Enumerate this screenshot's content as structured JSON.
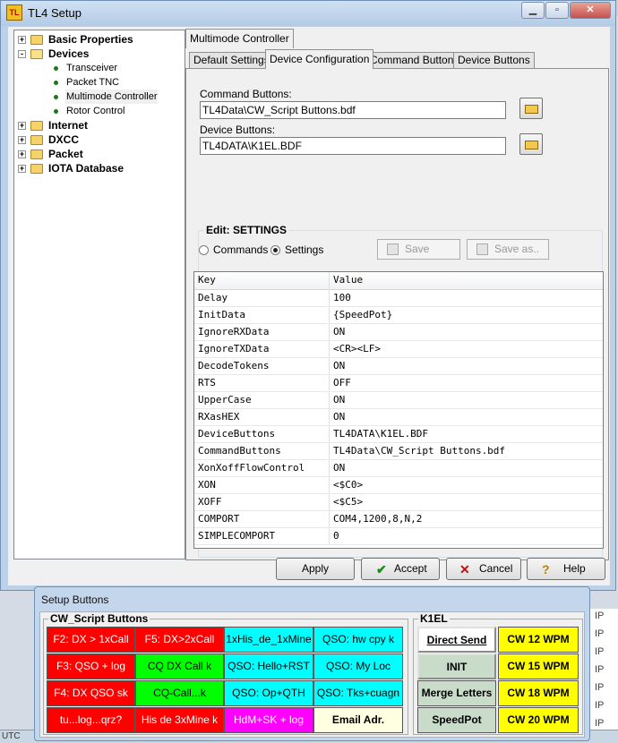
{
  "window": {
    "title": "TL4 Setup",
    "app_icon_text": "TL"
  },
  "tree": {
    "items": [
      {
        "label": "Basic Properties",
        "expander": "+"
      },
      {
        "label": "Devices",
        "expander": "-"
      },
      {
        "label": "Transceiver"
      },
      {
        "label": "Packet TNC"
      },
      {
        "label": "Multimode Controller"
      },
      {
        "label": "Rotor Control"
      },
      {
        "label": "Internet",
        "expander": "+"
      },
      {
        "label": "DXCC",
        "expander": "+"
      },
      {
        "label": "Packet",
        "expander": "+"
      },
      {
        "label": "IOTA Database",
        "expander": "+"
      }
    ]
  },
  "top_tab": {
    "label": "Multimode Controller"
  },
  "tabs": [
    {
      "label": "Default Settings"
    },
    {
      "label": "Device Configuration"
    },
    {
      "label": "Command Buttons"
    },
    {
      "label": "Device Buttons"
    }
  ],
  "config": {
    "command_buttons_label": "Command Buttons:",
    "command_buttons_value": "TL4Data\\CW_Script Buttons.bdf",
    "device_buttons_label": "Device Buttons:",
    "device_buttons_value": "TL4DATA\\K1EL.BDF"
  },
  "edit": {
    "title": "Edit: SETTINGS",
    "radio_commands": "Commands",
    "radio_settings": "Settings",
    "save": "Save",
    "save_as": "Save as.."
  },
  "grid": {
    "headers": [
      "Key",
      "Value"
    ],
    "rows": [
      {
        "key": "Delay",
        "value": "100"
      },
      {
        "key": "InitData",
        "value": "{SpeedPot}"
      },
      {
        "key": "IgnoreRXData",
        "value": "ON"
      },
      {
        "key": "IgnoreTXData",
        "value": "<CR><LF>"
      },
      {
        "key": "DecodeTokens",
        "value": "ON"
      },
      {
        "key": "RTS",
        "value": "OFF"
      },
      {
        "key": "UpperCase",
        "value": "ON"
      },
      {
        "key": "RXasHEX",
        "value": "ON"
      },
      {
        "key": "DeviceButtons",
        "value": "TL4DATA\\K1EL.BDF"
      },
      {
        "key": "CommandButtons",
        "value": "TL4Data\\CW_Script Buttons.bdf"
      },
      {
        "key": "XonXoffFlowControl",
        "value": "ON"
      },
      {
        "key": "XON",
        "value": "<$C0>"
      },
      {
        "key": "XOFF",
        "value": "<$C5>"
      },
      {
        "key": "COMPORT",
        "value": "COM4,1200,8,N,2"
      },
      {
        "key": "SIMPLECOMPORT",
        "value": "0"
      }
    ]
  },
  "footer": {
    "apply": "Apply",
    "accept": "Accept",
    "cancel": "Cancel",
    "help": "Help"
  },
  "setup_buttons": {
    "title": "Setup Buttons",
    "cw_group": "CW_Script Buttons",
    "k1el_group": "K1EL",
    "cw": [
      {
        "label": "F2: DX > 1xCall",
        "color": "#ff0000"
      },
      {
        "label": "F5: DX>2xCall",
        "color": "#ff0000"
      },
      {
        "label": "1xHis_de_1xMine",
        "color": "#00ffff"
      },
      {
        "label": "QSO: hw cpy k",
        "color": "#00ffff"
      },
      {
        "label": "F3: QSO + log",
        "color": "#ff0000"
      },
      {
        "label": "CQ DX Call k",
        "color": "#00ff00"
      },
      {
        "label": "QSO: Hello+RST",
        "color": "#00ffff"
      },
      {
        "label": "QSO: My Loc",
        "color": "#00ffff"
      },
      {
        "label": "F4: DX QSO sk",
        "color": "#ff0000"
      },
      {
        "label": "CQ-Call...k",
        "color": "#00ff00"
      },
      {
        "label": "QSO: Op+QTH",
        "color": "#00ffff"
      },
      {
        "label": "QSO: Tks+cuagn",
        "color": "#00ffff"
      },
      {
        "label": "tu...log...qrz?",
        "color": "#ff0000"
      },
      {
        "label": "His de 3xMine k",
        "color": "#ff0000"
      },
      {
        "label": "HdM+SK + log",
        "color": "#ff00ff"
      },
      {
        "label": "Email Adr.",
        "color": "#ffffe1"
      }
    ],
    "k1el": [
      {
        "label": "Direct Send"
      },
      {
        "label": "CW 12 WPM"
      },
      {
        "label": "INIT"
      },
      {
        "label": "CW 15 WPM"
      },
      {
        "label": "Merge Letters"
      },
      {
        "label": "CW 18 WPM"
      },
      {
        "label": "SpeedPot"
      },
      {
        "label": "CW 20 WPM"
      }
    ]
  },
  "background": {
    "ip_label": "IP",
    "status_text": "UTC"
  }
}
